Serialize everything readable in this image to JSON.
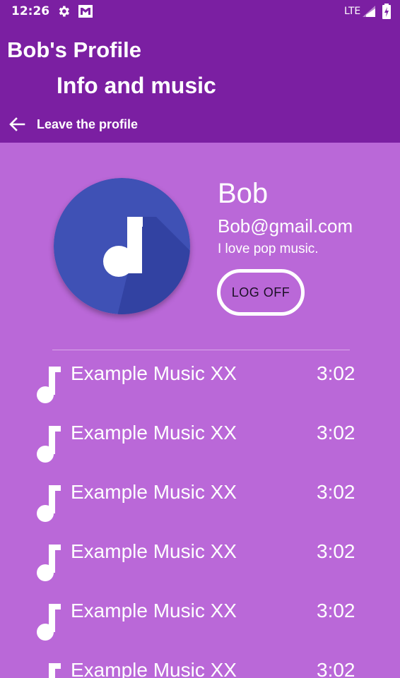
{
  "status_bar": {
    "time": "12:26",
    "network": "LTE",
    "icons": [
      "settings-icon",
      "mail-icon",
      "signal-icon",
      "battery-icon"
    ]
  },
  "app_bar": {
    "title": "Bob's Profile",
    "subtitle": "Info and music",
    "back_label": "Leave the profile",
    "back_icon": "arrow-left-icon"
  },
  "profile": {
    "avatar_icon": "music-note-icon",
    "name": "Bob",
    "email": "Bob@gmail.com",
    "bio": "I love pop music.",
    "logoff_label": "LOG OFF"
  },
  "tracks": [
    {
      "title": "Example Music XX",
      "duration": "3:02"
    },
    {
      "title": "Example Music XX",
      "duration": "3:02"
    },
    {
      "title": "Example Music XX",
      "duration": "3:02"
    },
    {
      "title": "Example Music XX",
      "duration": "3:02"
    },
    {
      "title": "Example Music XX",
      "duration": "3:02"
    },
    {
      "title": "Example Music XX",
      "duration": "3:02"
    }
  ],
  "colors": {
    "app_bar": "#7b1fa2",
    "background": "#ba68d8",
    "avatar": "#3f51b5",
    "text": "#ffffff"
  }
}
